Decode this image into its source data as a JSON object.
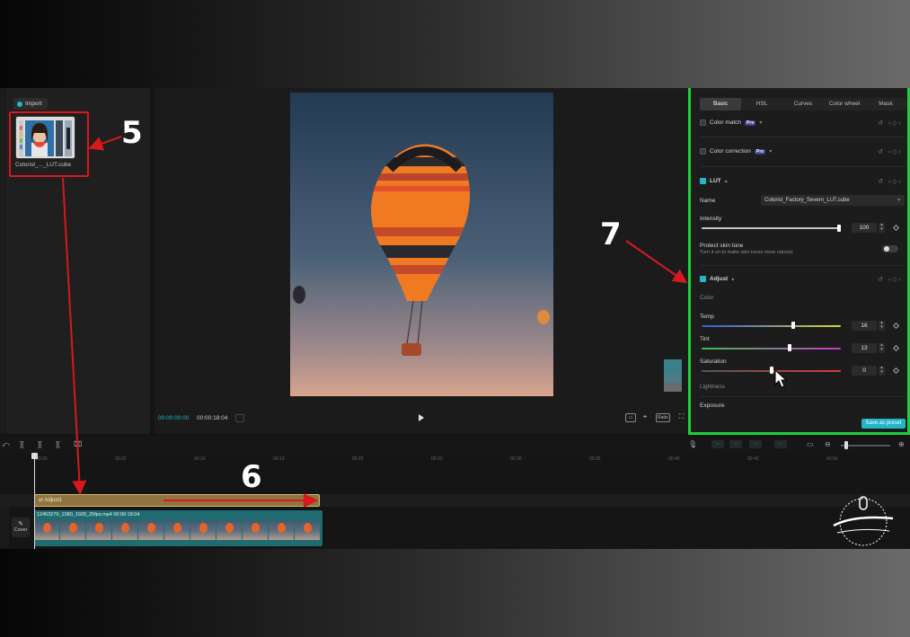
{
  "media": {
    "import_label": "Import",
    "file_name": "Colorist_..._LUT.cube"
  },
  "preview": {
    "timecode_current": "00:00:00:00",
    "timecode_total": "00:00:18:04",
    "ratio_label": "Ratio"
  },
  "right_panel": {
    "tabs": [
      {
        "label": "Basic"
      },
      {
        "label": "HSL"
      },
      {
        "label": "Curves"
      },
      {
        "label": "Color wheel"
      },
      {
        "label": "Mask"
      }
    ],
    "color_match": {
      "label": "Color match",
      "badge": "Pro"
    },
    "color_correction": {
      "label": "Color correction",
      "badge": "Pro"
    },
    "lut": {
      "label": "LUT",
      "name_label": "Name",
      "name_value": "Colorist_Factory_Severn_LUT.cube",
      "intensity_label": "Intensity",
      "intensity_value": "100",
      "intensity_level": 1.0,
      "protect_label": "Protect skin tone",
      "protect_desc": "Turn it on to make skin tones more natural."
    },
    "adjust": {
      "label": "Adjust",
      "color_label": "Color",
      "temp_label": "Temp",
      "temp_value": "16",
      "tint_label": "Tint",
      "tint_value": "13",
      "saturation_label": "Saturation",
      "saturation_value": "0",
      "lightness_label": "Lightness",
      "exposure_label": "Exposure"
    },
    "save_preset_label": "Save as preset"
  },
  "timeline": {
    "ruler": [
      "00:00",
      "00:02",
      "00:10",
      "00:13",
      "00:20",
      "00:23",
      "00:30",
      "00:32",
      "00:40",
      "00:43",
      "00:50"
    ],
    "adjust_clip_label": "Adjust1",
    "video_clip_name": "12453279_1080_1920_25fps.mp4",
    "video_clip_duration": "00:00:18:04",
    "cover_label": "Cover"
  },
  "annotations": {
    "num5": "5",
    "num6": "6",
    "num7": "7"
  },
  "colors": {
    "accent": "#22b6c8",
    "annotation_red": "#d7191c",
    "panel_highlight": "#1fcf3a",
    "adjust_clip": "#8f7440",
    "video_clip": "#1f6c70"
  }
}
